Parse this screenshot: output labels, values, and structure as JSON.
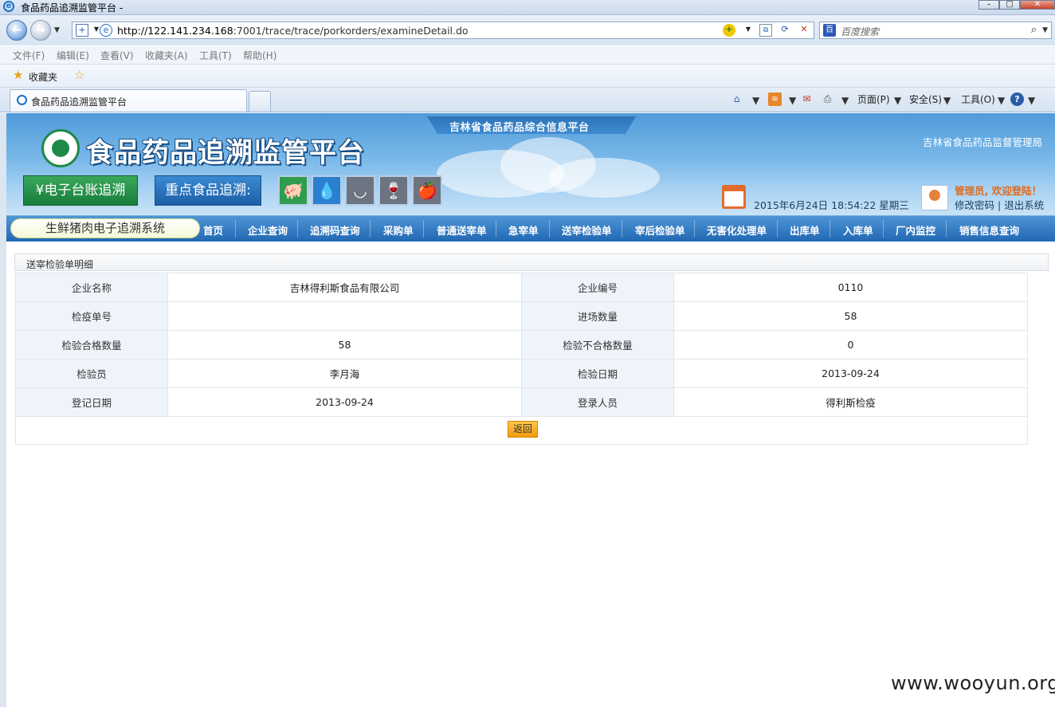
{
  "window": {
    "title": "食品药品追溯监管平台 -"
  },
  "address_bar": {
    "url_host": "http://122.141.234.168",
    "url_rest": ":7001/trace/trace/porkorders/examineDetail.do",
    "search_placeholder": "百度搜索"
  },
  "menu": [
    "文件(F)",
    "编辑(E)",
    "查看(V)",
    "收藏夹(A)",
    "工具(T)",
    "帮助(H)"
  ],
  "favorites": {
    "label": "收藏夹"
  },
  "tab": {
    "label": "食品药品追溯监管平台"
  },
  "command_bar": {
    "page": "页面(P)",
    "safety": "安全(S)",
    "tools": "工具(O)"
  },
  "header": {
    "platform_band": "吉林省食品药品综合信息平台",
    "site_name": "食品药品追溯监管平台",
    "bureau": "吉林省食品药品监督管理局",
    "btn_ledger": "¥电子台账追溯",
    "btn_key_food": "重点食品追溯:",
    "datetime": "2015年6月24日  18:54:22  星期三",
    "welcome": "管理员, 欢迎登陆！",
    "change_password": "修改密码",
    "separator": "|",
    "logout": "退出系统"
  },
  "nav": {
    "system_name": "生鲜猪肉电子追溯系统",
    "items": [
      "首页",
      "企业查询",
      "追溯码查询",
      "采购单",
      "普通送宰单",
      "急宰单",
      "送宰检验单",
      "宰后检验单",
      "无害化处理单",
      "出库单",
      "入库单",
      "厂内监控",
      "销售信息查询"
    ]
  },
  "panel": {
    "title": "送宰检验单明细"
  },
  "detail": {
    "rows": [
      {
        "l1": "企业名称",
        "v1": "吉林得利斯食品有限公司",
        "l2": "企业编号",
        "v2": "0110"
      },
      {
        "l1": "检疫单号",
        "v1": "",
        "l2": "进场数量",
        "v2": "58"
      },
      {
        "l1": "检验合格数量",
        "v1": "58",
        "l2": "检验不合格数量",
        "v2": "0"
      },
      {
        "l1": "检验员",
        "v1": "李月海",
        "l2": "检验日期",
        "v2": "2013-09-24"
      },
      {
        "l1": "登记日期",
        "v1": "2013-09-24",
        "l2": "登录人员",
        "v2": "得利斯检疫"
      }
    ],
    "back_button": "返回"
  },
  "watermark": "www.wooyun.org",
  "colors": {
    "nav_bg": "#2168b3",
    "label_cell_bg": "#eef4fa",
    "back_button": "#f29a0e",
    "welcome_text": "#e06a1e"
  }
}
